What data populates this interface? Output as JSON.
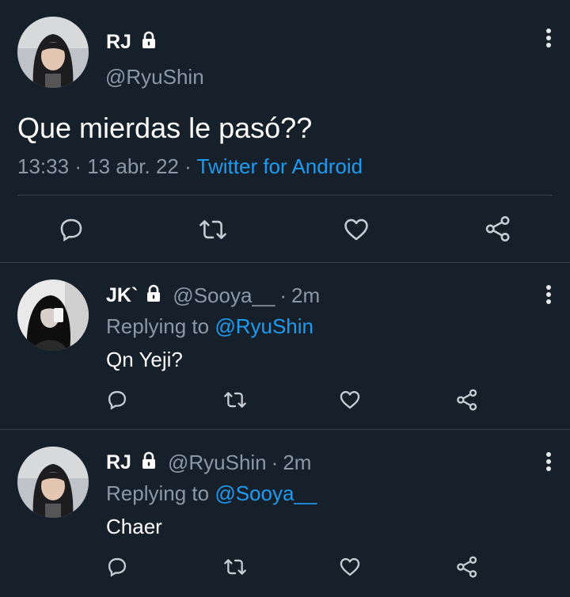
{
  "main_tweet": {
    "display_name": "RJ",
    "handle": "@RyuShin",
    "text": "Que mierdas le pasó??",
    "time": "13:33",
    "date": "13 abr. 22",
    "separator": "·",
    "source": "Twitter for Android"
  },
  "replies": [
    {
      "display_name": "JK`",
      "handle": "@Sooya__",
      "age": "2m",
      "replying_prefix": "Replying to",
      "replying_to": "@RyuShin",
      "text": "Qn Yeji?"
    },
    {
      "display_name": "RJ",
      "handle": "@RyuShin",
      "age": "2m",
      "replying_prefix": "Replying to",
      "replying_to": "@Sooya__",
      "text": "Chaer"
    }
  ],
  "colors": {
    "background": "#15202b",
    "text": "#ffffff",
    "muted": "#8b98a5",
    "accent": "#1d9bf0",
    "divider": "#38444d"
  },
  "icons": [
    "reply-icon",
    "retweet-icon",
    "like-icon",
    "share-icon",
    "lock-icon",
    "more-options-icon"
  ]
}
